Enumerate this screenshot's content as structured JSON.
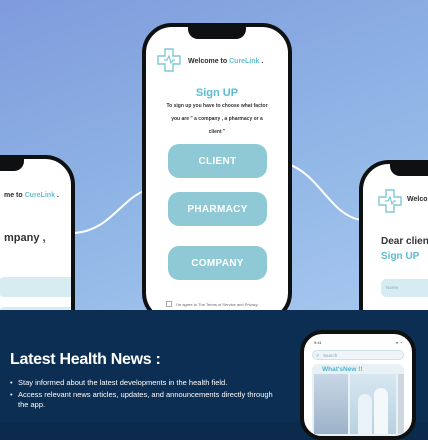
{
  "brand": "CureLink",
  "welcome_prefix": "Welcome to",
  "welcome_suffix": ".",
  "signup": {
    "title": "Sign UP",
    "description_line1": "To sign up you have to choose what factor",
    "description_line2": "you are \" a company , a pharmacy or a",
    "description_line3": "client \"",
    "options": [
      "CLIENT",
      "PHARMACY",
      "COMPANY"
    ],
    "terms": "I'm agree to The Terms of Service and Privacy"
  },
  "left_phone": {
    "welcome_partial": "me to",
    "brand": "CureLink",
    "text_partial": "mpany ,"
  },
  "right_phone": {
    "welcome_partial": "Welco",
    "greeting_partial": "Dear clien",
    "title": "Sign UP",
    "field_placeholder": "Name"
  },
  "news": {
    "title": "Latest Health News :",
    "bullets": [
      "Stay informed about the latest developments in the health field.",
      "Access relevant news articles, updates, and announcements directly through the app."
    ]
  },
  "news_phone": {
    "search_placeholder": "Search",
    "heading": "What'sNew !!"
  },
  "colors": {
    "accent": "#5dbbd0",
    "button": "#90c9d6",
    "background_top": "#8aaee3",
    "background_bottom": "#0c2e52"
  }
}
